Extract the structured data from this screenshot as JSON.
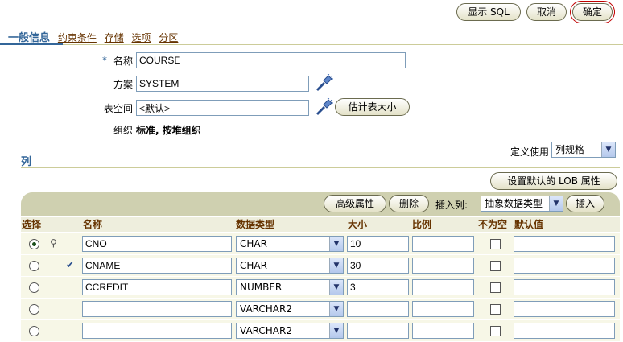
{
  "toolbar_top": {
    "show_sql": "显示 SQL",
    "cancel": "取消",
    "ok": "确定"
  },
  "tabs": [
    {
      "label": "一般信息",
      "active": true
    },
    {
      "label": "约束条件"
    },
    {
      "label": "存储"
    },
    {
      "label": "选项"
    },
    {
      "label": "分区"
    }
  ],
  "form": {
    "name_label": "名称",
    "name_value": "COURSE",
    "schema_label": "方案",
    "schema_value": "SYSTEM",
    "tablespace_label": "表空间",
    "tablespace_value": "<默认>",
    "estimate_btn": "估计表大小",
    "org_label": "组织",
    "org_value": "标准, 按堆组织",
    "required_marker": "*"
  },
  "columns_section": {
    "title": "列",
    "define_using_label": "定义使用",
    "define_using_value": "列规格",
    "lob_btn": "设置默认的 LOB 属性",
    "advanced_btn": "高级属性",
    "delete_btn": "删除",
    "insert_label": "插入列:",
    "insert_type": "抽象数据类型",
    "insert_btn": "插入"
  },
  "table": {
    "headers": [
      "选择",
      "",
      "名称",
      "数据类型",
      "大小",
      "比例",
      "不为空",
      "默认值"
    ],
    "rows": [
      {
        "selected": true,
        "marker": "key",
        "name": "CNO",
        "type": "CHAR",
        "size": "10",
        "scale": "",
        "not_null": false,
        "default": ""
      },
      {
        "selected": false,
        "marker": "check",
        "name": "CNAME",
        "type": "CHAR",
        "size": "30",
        "scale": "",
        "not_null": false,
        "default": ""
      },
      {
        "selected": false,
        "marker": "",
        "name": "CCREDIT",
        "type": "NUMBER",
        "size": "3",
        "scale": "",
        "not_null": false,
        "default": ""
      },
      {
        "selected": false,
        "marker": "",
        "name": "",
        "type": "VARCHAR2",
        "size": "",
        "scale": "",
        "not_null": false,
        "default": ""
      },
      {
        "selected": false,
        "marker": "",
        "name": "",
        "type": "VARCHAR2",
        "size": "",
        "scale": "",
        "not_null": false,
        "default": ""
      }
    ]
  },
  "colors": {
    "section_blue": "#336699",
    "header_brown": "#663300",
    "bar_beige": "#cfd0b0"
  }
}
